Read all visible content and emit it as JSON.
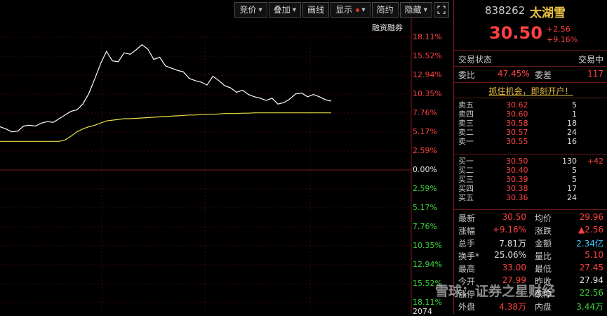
{
  "toolbar": {
    "bid": "竞价",
    "overlay": "叠加",
    "draw": "画线",
    "display": "显示",
    "simple": "简约",
    "hide": "隐藏"
  },
  "chart": {
    "margin_label": "融资融券",
    "up_pct": [
      "18.11%",
      "15.52%",
      "12.94%",
      "10.35%",
      "7.76%",
      "5.17%",
      "2.59%"
    ],
    "zero_pct": "0.00%",
    "down_pct": [
      "2.59%",
      "5.17%",
      "7.76%",
      "10.35%",
      "12.94%",
      "15.52%",
      "18.11%"
    ],
    "volume_label": "2074"
  },
  "chart_data": {
    "type": "line",
    "title": "",
    "xlabel": "",
    "ylabel": "",
    "ylim_pct": [
      -18.11,
      18.11
    ],
    "series": [
      {
        "values": [
          5.9,
          5.6,
          5.2,
          5.3,
          6.0,
          6.1,
          6.0,
          6.4,
          6.6,
          6.5,
          7.0,
          7.5,
          8.0,
          8.2,
          9.0,
          10.4,
          12.4,
          14.5,
          16.2,
          14.9,
          14.8,
          16.0,
          15.8,
          16.4,
          17.1,
          16.5,
          15.1,
          15.4,
          14.2,
          13.9,
          13.6,
          13.4,
          12.5,
          12.2,
          12.0,
          11.6,
          12.8,
          12.2,
          11.5,
          11.2,
          10.6,
          10.9,
          10.3,
          10.0,
          9.8,
          9.5,
          9.8,
          9.0,
          9.2,
          9.7,
          10.4,
          10.5,
          10.0,
          10.3,
          10.0,
          9.6,
          9.4
        ]
      },
      {
        "values": [
          3.9,
          3.9,
          3.9,
          3.9,
          3.9,
          3.9,
          3.9,
          3.9,
          3.9,
          3.9,
          3.9,
          4.1,
          4.6,
          5.2,
          5.6,
          5.9,
          6.1,
          6.4,
          6.7,
          6.8,
          6.9,
          7.0,
          7.0,
          7.05,
          7.1,
          7.15,
          7.2,
          7.25,
          7.3,
          7.35,
          7.4,
          7.45,
          7.5,
          7.5,
          7.55,
          7.6,
          7.6,
          7.65,
          7.7,
          7.7,
          7.7,
          7.75,
          7.75,
          7.8,
          7.8,
          7.8,
          7.8,
          7.8,
          7.8,
          7.8,
          7.8,
          7.8,
          7.8,
          7.8,
          7.8,
          7.8,
          7.8
        ]
      }
    ],
    "grid": true,
    "colors": {
      "price": "#ffffff",
      "avg": "#e8e040"
    }
  },
  "quote": {
    "code": "838262",
    "name": "太湖雪",
    "price": "30.50",
    "change": "+2.56",
    "change_pct": "+9.16%",
    "status_label": "交易状态",
    "status_value": "交易中",
    "wb_label": "委比",
    "wb_value": "47.45%",
    "wc_label": "委差",
    "wc_value": "117",
    "promo": "抓住机会，即刻开户！"
  },
  "asks": [
    {
      "label": "卖五",
      "price": "30.62",
      "vol": "5"
    },
    {
      "label": "卖四",
      "price": "30.60",
      "vol": "1"
    },
    {
      "label": "卖三",
      "price": "30.58",
      "vol": "18"
    },
    {
      "label": "卖二",
      "price": "30.57",
      "vol": "24"
    },
    {
      "label": "卖一",
      "price": "30.55",
      "vol": "16"
    }
  ],
  "bids": [
    {
      "label": "买一",
      "price": "30.50",
      "vol": "130",
      "extra": "+42"
    },
    {
      "label": "买二",
      "price": "30.40",
      "vol": "5",
      "extra": ""
    },
    {
      "label": "买三",
      "price": "30.39",
      "vol": "5",
      "extra": ""
    },
    {
      "label": "买四",
      "price": "30.38",
      "vol": "17",
      "extra": ""
    },
    {
      "label": "买五",
      "price": "30.36",
      "vol": "24",
      "extra": ""
    }
  ],
  "stats": [
    {
      "l1": "最新",
      "v1": "30.50",
      "l2": "均价",
      "v2": "29.96",
      "c1": "red",
      "c2": "red"
    },
    {
      "l1": "涨幅",
      "v1": "+9.16%",
      "l2": "涨跌",
      "v2": "▲2.56",
      "c1": "red",
      "c2": "red"
    },
    {
      "l1": "总手",
      "v1": "7.81万",
      "l2": "金额",
      "v2": "2.34亿",
      "c1": "wht",
      "c2": "cyan"
    },
    {
      "l1": "换手*",
      "v1": "25.06%",
      "l2": "量比",
      "v2": "5.10",
      "c1": "wht",
      "c2": "red"
    },
    {
      "l1": "最高",
      "v1": "33.00",
      "l2": "最低",
      "v2": "27.45",
      "c1": "red",
      "c2": "red"
    },
    {
      "l1": "今开",
      "v1": "27.99",
      "l2": "昨收",
      "v2": "27.94",
      "c1": "red",
      "c2": "wht"
    },
    {
      "l1": "涨停",
      "v1": "",
      "l2": "跌停",
      "v2": "22.56",
      "c1": "red",
      "c2": "grn"
    },
    {
      "l1": "外盘",
      "v1": "4.38万",
      "l2": "内盘",
      "v2": "3.44万",
      "c1": "red",
      "c2": "grn"
    }
  ],
  "watermark": "雪球：证券之星财经"
}
